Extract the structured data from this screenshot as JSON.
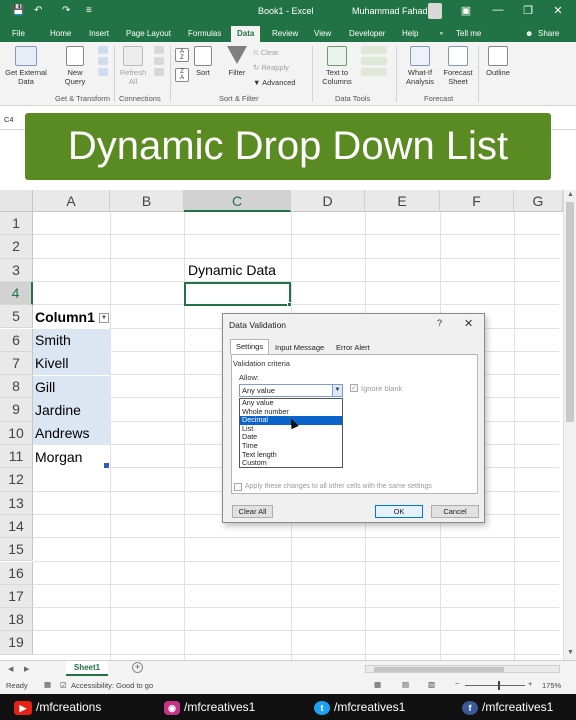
{
  "titlebar": {
    "doc_title": "Book1 - Excel",
    "user_name": "Muhammad Fahad",
    "minimize": "—",
    "restore": "❐",
    "close": "✕"
  },
  "tabs": [
    "File",
    "Home",
    "Insert",
    "Page Layout",
    "Formulas",
    "Data",
    "Review",
    "View",
    "Developer",
    "Help"
  ],
  "active_tab": "Data",
  "tell_me": "Tell me",
  "share": "Share",
  "ribbon": {
    "get_external_data": "Get External Data",
    "new_query": "New Query",
    "refresh_all": "Refresh All",
    "sort": "Sort",
    "filter": "Filter",
    "clear": "Clear",
    "reapply": "Reapply",
    "advanced": "Advanced",
    "text_to_columns": "Text to Columns",
    "what_if": "What-If Analysis",
    "forecast_sheet": "Forecast Sheet",
    "outline": "Outline",
    "groups": {
      "get_transform": "Get & Transform",
      "connections": "Connections",
      "sort_filter": "Sort & Filter",
      "data_tools": "Data Tools",
      "forecast": "Forecast"
    }
  },
  "name_box": "C4",
  "banner_title": "Dynamic Drop Down List",
  "columns": [
    "A",
    "B",
    "C",
    "D",
    "E",
    "F",
    "G"
  ],
  "rows": [
    "1",
    "2",
    "3",
    "4",
    "5",
    "6",
    "7",
    "8",
    "9",
    "10",
    "11",
    "12",
    "13",
    "14",
    "15",
    "16",
    "17",
    "18",
    "19"
  ],
  "cells": {
    "c3": "Dynamic Data",
    "a5": "Column1",
    "a6": "Smith",
    "a7": "Kivell",
    "a8": "Gill",
    "a9": "Jardine",
    "a10": "Andrews",
    "a11": "Morgan"
  },
  "dialog": {
    "title": "Data Validation",
    "help": "?",
    "close": "✕",
    "tabs": [
      "Settings",
      "Input Message",
      "Error Alert"
    ],
    "criteria_label": "Validation criteria",
    "allow_label": "Allow:",
    "allow_value": "Any value",
    "ignore_blank": "Ignore blank",
    "options": [
      "Any value",
      "Whole number",
      "Decimal",
      "List",
      "Date",
      "Time",
      "Text length",
      "Custom"
    ],
    "highlighted_option": "Decimal",
    "apply_all": "Apply these changes to all other cells with the same settings",
    "clear_all": "Clear All",
    "ok": "OK",
    "cancel": "Cancel"
  },
  "sheet_tab": "Sheet1",
  "status": {
    "ready": "Ready",
    "accessibility": "Accessibility: Good to go",
    "zoom": "175%"
  },
  "social": {
    "youtube": "/mfcreations",
    "instagram": "/mfcreatives1",
    "twitter": "/mfcreatives1",
    "facebook": "/mfcreatives1"
  },
  "colors": {
    "excel_green": "#217346",
    "banner_green": "#5a8a22",
    "table_fill": "#dce6f2",
    "highlight_blue": "#0a64c9"
  }
}
